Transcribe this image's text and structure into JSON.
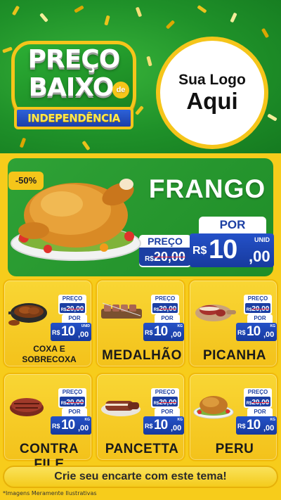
{
  "header": {
    "badge_line1": "PREÇO",
    "badge_line2": "BAIXO",
    "badge_de": "de",
    "badge_ribbon": "INDEPENDÊNCIA",
    "logo_line1": "Sua Logo",
    "logo_line2": "Aqui",
    "background_color": "#1f9129",
    "accent_color": "#f5c51a"
  },
  "hero": {
    "discount": "-50%",
    "title": "FRANGO",
    "old_label": "PREÇO",
    "old_currency": "R$",
    "old_value": "20,00",
    "por_label": "POR",
    "currency": "R$",
    "price_int": "10",
    "price_cents": ",00",
    "unit": "UNID"
  },
  "products": [
    {
      "name_line1": "COXA E",
      "name_line2": "SOBRECOXA",
      "old_label": "PREÇO",
      "old_currency": "R$",
      "old_value": "20,00",
      "por_label": "POR",
      "currency": "R$",
      "price_int": "10",
      "price_cents": ",00",
      "unit": "UNID"
    },
    {
      "name_line1": "MEDALHÃO",
      "old_label": "PREÇO",
      "old_currency": "R$",
      "old_value": "20,00",
      "por_label": "POR",
      "currency": "R$",
      "price_int": "10",
      "price_cents": ",00",
      "unit": "KG"
    },
    {
      "name_line1": "PICANHA",
      "old_label": "PREÇO",
      "old_currency": "R$",
      "old_value": "20,00",
      "por_label": "POR",
      "currency": "R$",
      "price_int": "10",
      "price_cents": ",00",
      "unit": "KG"
    },
    {
      "name_line1": "CONTRA FILE",
      "old_label": "PREÇO",
      "old_currency": "R$",
      "old_value": "20,00",
      "por_label": "POR",
      "currency": "R$",
      "price_int": "10",
      "price_cents": ",00",
      "unit": "KG"
    },
    {
      "name_line1": "PANCETTA",
      "old_label": "PREÇO",
      "old_currency": "R$",
      "old_value": "20,00",
      "por_label": "POR",
      "currency": "R$",
      "price_int": "10",
      "price_cents": ",00",
      "unit": "KG"
    },
    {
      "name_line1": "PERU",
      "old_label": "PREÇO",
      "old_currency": "R$",
      "old_value": "20,00",
      "por_label": "POR",
      "currency": "R$",
      "price_int": "10",
      "price_cents": ",00",
      "unit": "KG"
    }
  ],
  "footer": {
    "cta": "Crie seu encarte com este tema!",
    "disclaimer": "*Imagens Meramente Ilustrativas"
  },
  "colors": {
    "price_blue": "#1c3fa3",
    "panel_yellow": "#f7cc1b",
    "hero_green": "#2fa236"
  }
}
